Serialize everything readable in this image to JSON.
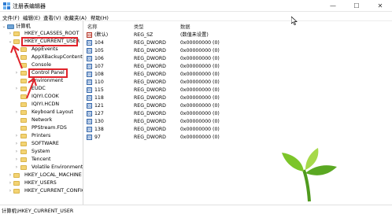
{
  "window": {
    "title": "注册表编辑器"
  },
  "window_controls": {
    "minimize": "—",
    "maximize": "☐",
    "close": "✕"
  },
  "menu": [
    "文件(F)",
    "编辑(E)",
    "查看(V)",
    "收藏夹(A)",
    "帮助(H)"
  ],
  "tree": {
    "root": "计算机",
    "items": [
      {
        "label": "HKEY_CLASSES_ROOT"
      },
      {
        "label": "HKEY_CURRENT_USER"
      },
      {
        "label": "AppEvents"
      },
      {
        "label": "AppXBackupContent"
      },
      {
        "label": "Console"
      },
      {
        "label": "Control Panel"
      },
      {
        "label": "Environment"
      },
      {
        "label": "EUDC"
      },
      {
        "label": "IQIYI.COOK"
      },
      {
        "label": "IQIYI.HCDN"
      },
      {
        "label": "Keyboard Layout"
      },
      {
        "label": "Network"
      },
      {
        "label": "PPStream.FDS"
      },
      {
        "label": "Printers"
      },
      {
        "label": "SOFTWARE"
      },
      {
        "label": "System"
      },
      {
        "label": "Tencent"
      },
      {
        "label": "Volatile Environment"
      },
      {
        "label": "HKEY_LOCAL_MACHINE"
      },
      {
        "label": "HKEY_USERS"
      },
      {
        "label": "HKEY_CURRENT_CONFIG"
      }
    ]
  },
  "columns": {
    "name": "名称",
    "type": "类型",
    "data": "数据"
  },
  "values": [
    {
      "name": "(默认)",
      "type": "REG_SZ",
      "data": "(数值未设置)",
      "icon": "string-value-icon"
    },
    {
      "name": "104",
      "type": "REG_DWORD",
      "data": "0x00000000 (0)",
      "icon": "binary-value-icon"
    },
    {
      "name": "105",
      "type": "REG_DWORD",
      "data": "0x00000000 (0)",
      "icon": "binary-value-icon"
    },
    {
      "name": "106",
      "type": "REG_DWORD",
      "data": "0x00000000 (0)",
      "icon": "binary-value-icon"
    },
    {
      "name": "107",
      "type": "REG_DWORD",
      "data": "0x00000000 (0)",
      "icon": "binary-value-icon"
    },
    {
      "name": "108",
      "type": "REG_DWORD",
      "data": "0x00000000 (0)",
      "icon": "binary-value-icon"
    },
    {
      "name": "110",
      "type": "REG_DWORD",
      "data": "0x00000000 (0)",
      "icon": "binary-value-icon"
    },
    {
      "name": "115",
      "type": "REG_DWORD",
      "data": "0x00000000 (0)",
      "icon": "binary-value-icon"
    },
    {
      "name": "118",
      "type": "REG_DWORD",
      "data": "0x00000000 (0)",
      "icon": "binary-value-icon"
    },
    {
      "name": "121",
      "type": "REG_DWORD",
      "data": "0x00000000 (0)",
      "icon": "binary-value-icon"
    },
    {
      "name": "127",
      "type": "REG_DWORD",
      "data": "0x00000000 (0)",
      "icon": "binary-value-icon"
    },
    {
      "name": "130",
      "type": "REG_DWORD",
      "data": "0x00000000 (0)",
      "icon": "binary-value-icon"
    },
    {
      "name": "138",
      "type": "REG_DWORD",
      "data": "0x00000000 (0)",
      "icon": "binary-value-icon"
    },
    {
      "name": "97",
      "type": "REG_DWORD",
      "data": "0x00000000 (0)",
      "icon": "binary-value-icon"
    }
  ],
  "status": {
    "path": "计算机\\HKEY_CURRENT_USER"
  },
  "colors": {
    "annotation_red": "#e0242b",
    "folder": "#f3d373",
    "selection": "#cce8ff"
  }
}
